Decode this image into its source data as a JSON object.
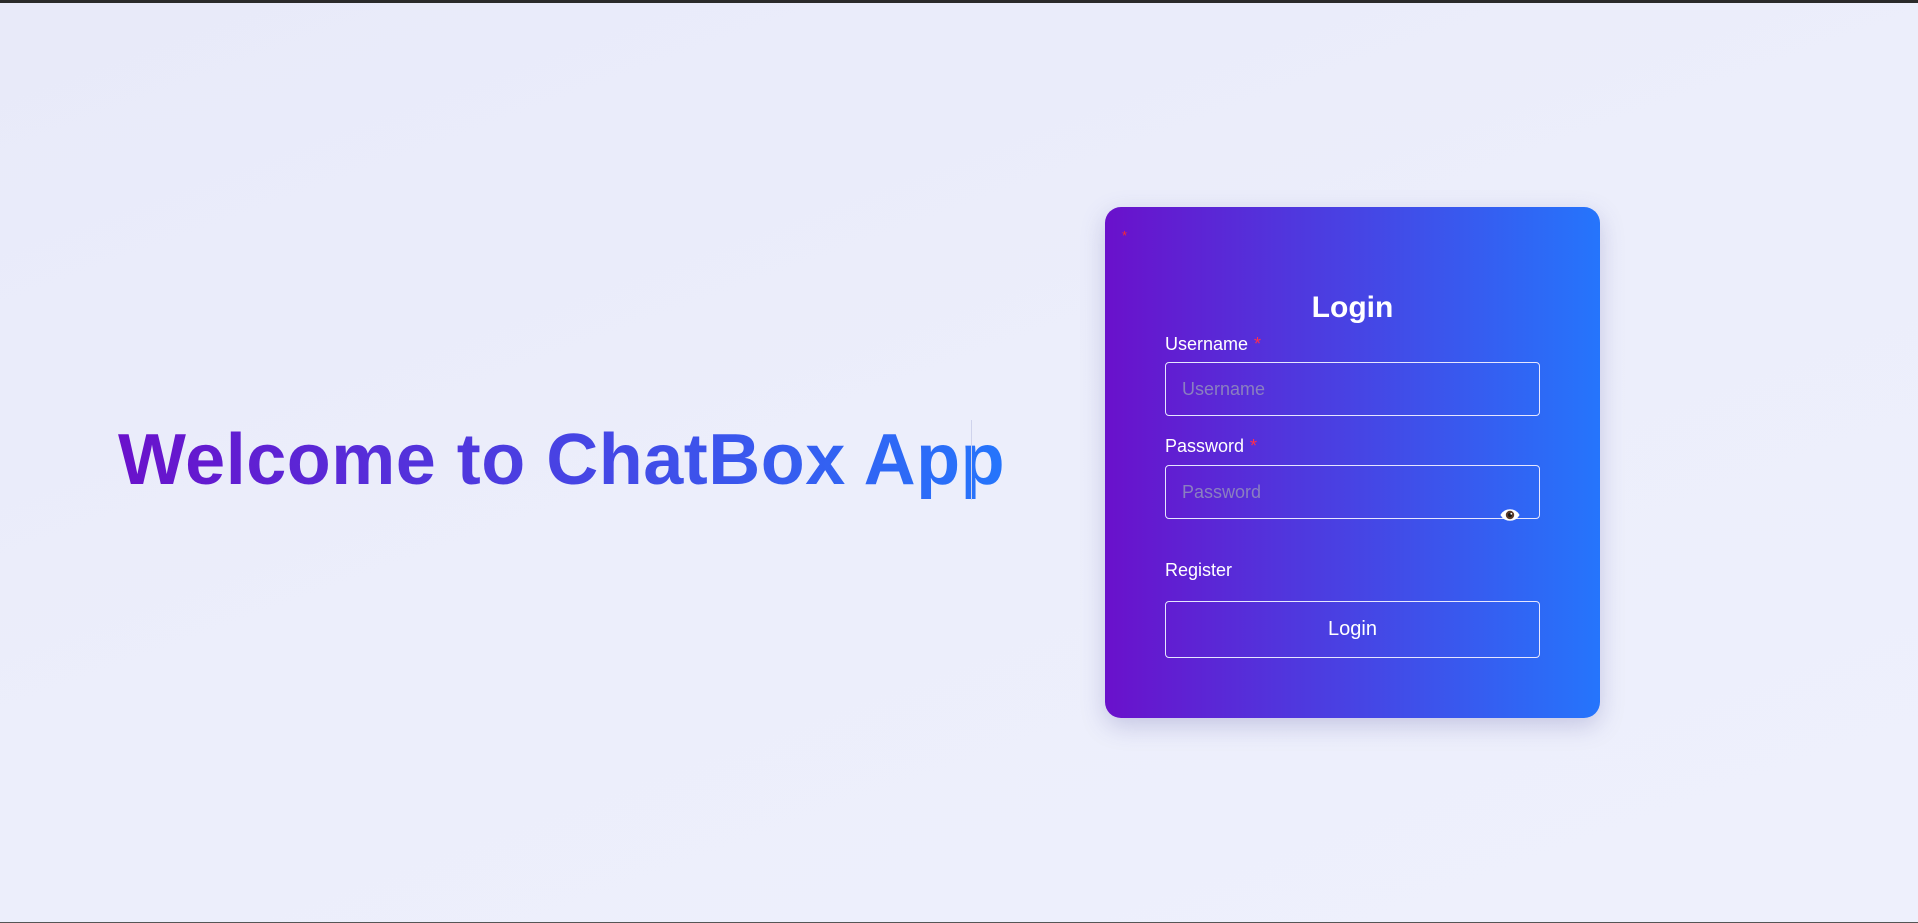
{
  "hero": {
    "title": "Welcome to ChatBox App"
  },
  "login_card": {
    "corner_mark": "*",
    "title": "Login",
    "username": {
      "label": "Username",
      "required_mark": "*",
      "placeholder": "Username",
      "value": ""
    },
    "password": {
      "label": "Password",
      "required_mark": "*",
      "placeholder": "Password",
      "value": "",
      "toggle_icon": "eye-icon"
    },
    "register_link": "Register",
    "submit_label": "Login"
  },
  "colors": {
    "gradient_start": "#6a11cb",
    "gradient_end": "#2575fc",
    "required": "#ff2e4c",
    "page_background": "#eceefb"
  }
}
